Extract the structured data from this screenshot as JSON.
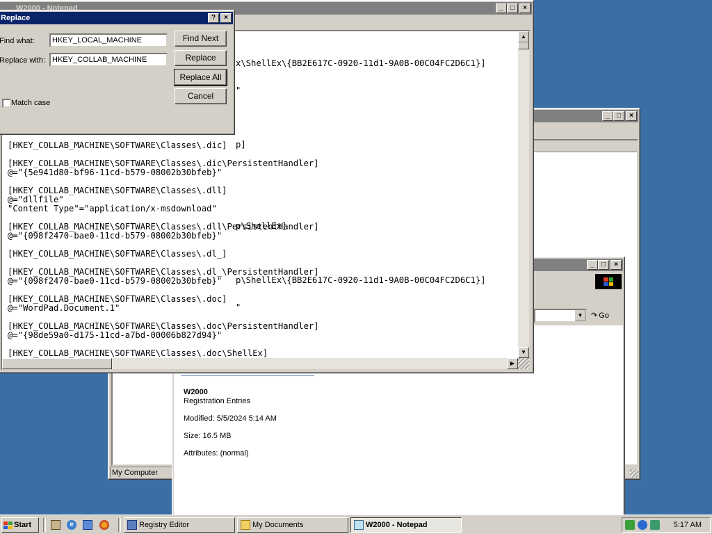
{
  "notepad": {
    "title": "W2000 - Notepad",
    "lines_visible": [
      "x\\ShellEx\\{BB2E617C-0920-11d1-9A0B-00C04FC2D6C1}]",
      "\"",
      "",
      "p]",
      "",
      "",
      "p\\ShellEx]",
      "",
      "p\\ShellEx\\{BB2E617C-0920-11d1-9A0B-00C04FC2D6C1}]",
      "\""
    ],
    "lines": [
      "[HKEY_COLLAB_MACHINE\\SOFTWARE\\Classes\\.dic]",
      "",
      "[HKEY_COLLAB_MACHINE\\SOFTWARE\\Classes\\.dic\\PersistentHandler]",
      "@=\"{5e941d80-bf96-11cd-b579-08002b30bfeb}\"",
      "",
      "[HKEY_COLLAB_MACHINE\\SOFTWARE\\Classes\\.dll]",
      "@=\"dllfile\"",
      "\"Content Type\"=\"application/x-msdownload\"",
      "",
      "[HKEY_COLLAB_MACHINE\\SOFTWARE\\Classes\\.dll\\PersistentHandler]",
      "@=\"{098f2470-bae0-11cd-b579-08002b30bfeb}\"",
      "",
      "[HKEY_COLLAB_MACHINE\\SOFTWARE\\Classes\\.dl_]",
      "",
      "[HKEY_COLLAB_MACHINE\\SOFTWARE\\Classes\\.dl_\\PersistentHandler]",
      "@=\"{098f2470-bae0-11cd-b579-08002b30bfeb}\"",
      "",
      "[HKEY_COLLAB_MACHINE\\SOFTWARE\\Classes\\.doc]",
      "@=\"WordPad.Document.1\"",
      "",
      "[HKEY_COLLAB_MACHINE\\SOFTWARE\\Classes\\.doc\\PersistentHandler]",
      "@=\"{98de59a0-d175-11cd-a7bd-00006b827d94}\"",
      "",
      "[HKEY_COLLAB_MACHINE\\SOFTWARE\\Classes\\.doc\\ShellEx]"
    ]
  },
  "replace_dialog": {
    "title": "Replace",
    "find_label": "Find what:",
    "find_value": "HKEY_LOCAL_MACHINE",
    "replace_label": "Replace with:",
    "replace_value": "HKEY_COLLAB_MACHINE",
    "match_case_label": "Match case",
    "match_case_checked": false,
    "buttons": {
      "find_next": "Find Next",
      "replace": "Replace",
      "replace_all": "Replace All",
      "cancel": "Cancel"
    }
  },
  "my_documents": {
    "address_go": "Go",
    "status_left": "My Computer",
    "file_info": {
      "name": "W2000",
      "type": "Registration Entries",
      "modified": "Modified: 5/5/2024 5:14 AM",
      "size": "Size: 16.5 MB",
      "attributes": "Attributes: (normal)"
    }
  },
  "taskbar": {
    "start_label": "Start",
    "buttons": [
      {
        "label": "Registry Editor",
        "active": false
      },
      {
        "label": "My Documents",
        "active": false
      },
      {
        "label": "W2000 - Notepad",
        "active": true
      }
    ],
    "clock": "5:17 AM"
  },
  "colors": {
    "desktop": "#3a6ea5",
    "active_title": "#0a246a",
    "inactive_title": "#808080",
    "face": "#d4d0c8"
  }
}
